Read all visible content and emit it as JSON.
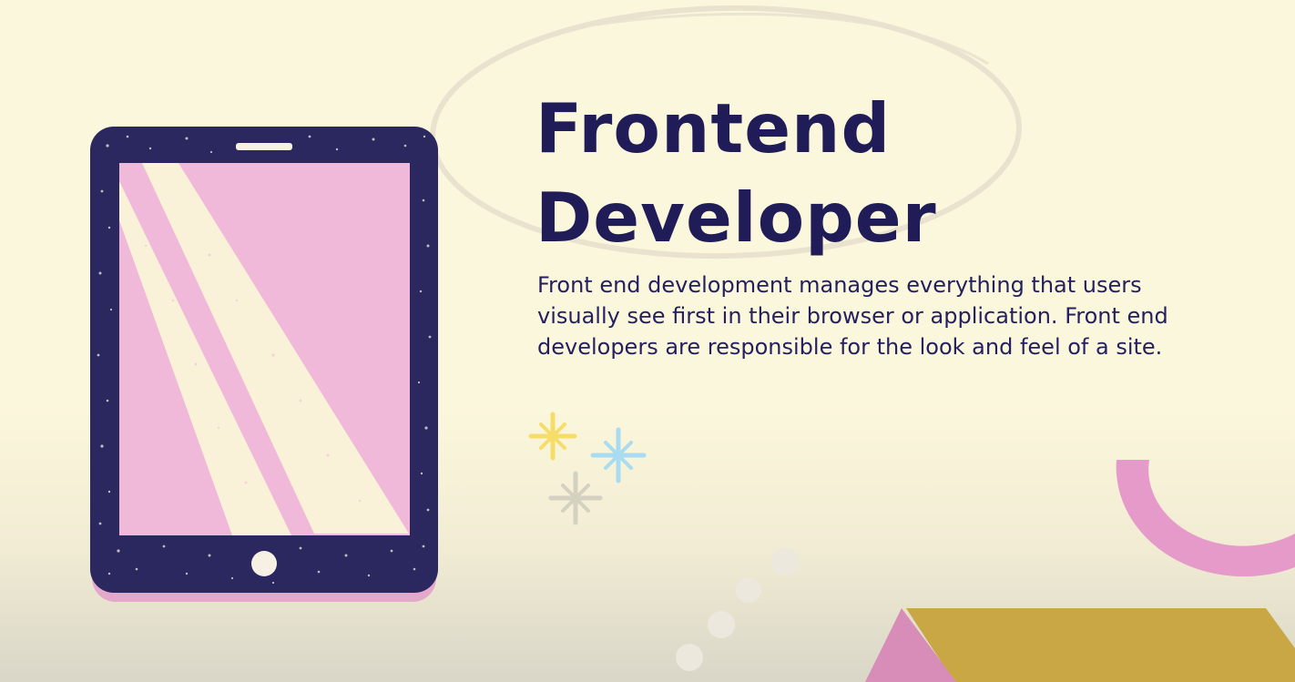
{
  "slide": {
    "title_line1": "Frontend",
    "title_line2": "Developer",
    "description_line1": "Front end development manages everything that users",
    "description_line2": "visually see first in their browser or application. Front end",
    "description_line3": "developers are responsible for the look and feel of a site."
  },
  "colors": {
    "background": "#fbf7dc",
    "title": "#1f1c57",
    "tablet_frame": "#2b275f",
    "tablet_screen": "#f0b8d9",
    "light_beam": "#f9f2d9",
    "accent_pink": "#e98fc8",
    "accent_gold": "#c8a744",
    "star_yellow": "#f6dd6a",
    "star_blue": "#a9dcf0",
    "star_gray": "#d5d1c1"
  },
  "icons": {
    "tablet": "tablet-illustration",
    "sparkle": "sparkle-icon",
    "arc": "half-ring-decoration",
    "dots": "dot-trail-decoration",
    "triangles": "triangle-decoration"
  }
}
